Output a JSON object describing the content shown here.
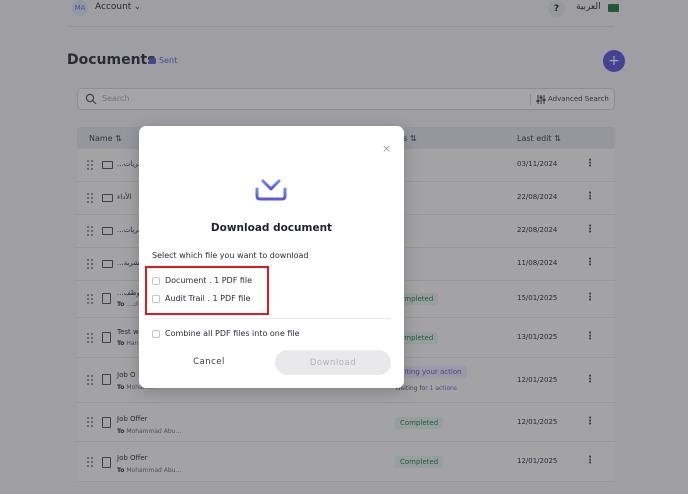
{
  "header": {
    "avatar_initials": "MA",
    "account_label": "Account",
    "help_label": "?",
    "language_label": "العربية"
  },
  "page": {
    "title": "Documents",
    "sent_tag": "Sent",
    "add_button": "+"
  },
  "search": {
    "placeholder": "Search",
    "advanced_label": "Advanced Search"
  },
  "table": {
    "columns": {
      "name": "Name ⇅",
      "status": "tus ⇅",
      "last_edit": "Last edit ⇅"
    },
    "rows": [
      {
        "type": "folder",
        "name": "...تحريات",
        "to": "",
        "status": "",
        "date": "03/11/2024"
      },
      {
        "type": "folder",
        "name": "الأداء",
        "to": "",
        "status": "",
        "date": "22/08/2024"
      },
      {
        "type": "folder",
        "name": "...تحريات",
        "to": "",
        "status": "",
        "date": "22/08/2024"
      },
      {
        "type": "folder",
        "name": "...د الشرية",
        "to": "",
        "status": "",
        "date": "11/08/2024"
      },
      {
        "type": "file",
        "name": "...للموظف",
        "to_prefix": "To",
        "to": "...براك",
        "status": "ompleted",
        "date": "15/01/2025"
      },
      {
        "type": "file",
        "name": "Test w",
        "to_prefix": "To",
        "to": "Han",
        "status": "ompleted",
        "date": "13/01/2025"
      },
      {
        "type": "file",
        "name": "Job O",
        "to_prefix": "To",
        "to": "Mohamm",
        "status": "aiting your action",
        "waiting_text": "Waiting for",
        "waiting_link": "1 actions",
        "date": "12/01/2025"
      },
      {
        "type": "file",
        "name": "Job Offer",
        "to_prefix": "To",
        "to": "Mohammad Abu...",
        "status": "Completed",
        "date": "12/01/2025"
      },
      {
        "type": "file",
        "name": "Job Offer",
        "to_prefix": "To",
        "to": "Mohammad Abu...",
        "status": "Completed",
        "date": "12/01/2025"
      }
    ],
    "kebab": "⋮"
  },
  "modal": {
    "close_label": "×",
    "title": "Download document",
    "subtitle": "Select which file you want to download",
    "options": [
      {
        "label": "Document . 1 PDF file",
        "checked": false
      },
      {
        "label": "Audit Trail . 1 PDF file",
        "checked": false
      }
    ],
    "combine_label": "Combine all PDF files into one file",
    "cancel_label": "Cancel",
    "download_label": "Download"
  },
  "colors": {
    "accent": "#5b55e0",
    "highlight_box": "#e0181f",
    "completed_text": "#1d7d4a"
  }
}
